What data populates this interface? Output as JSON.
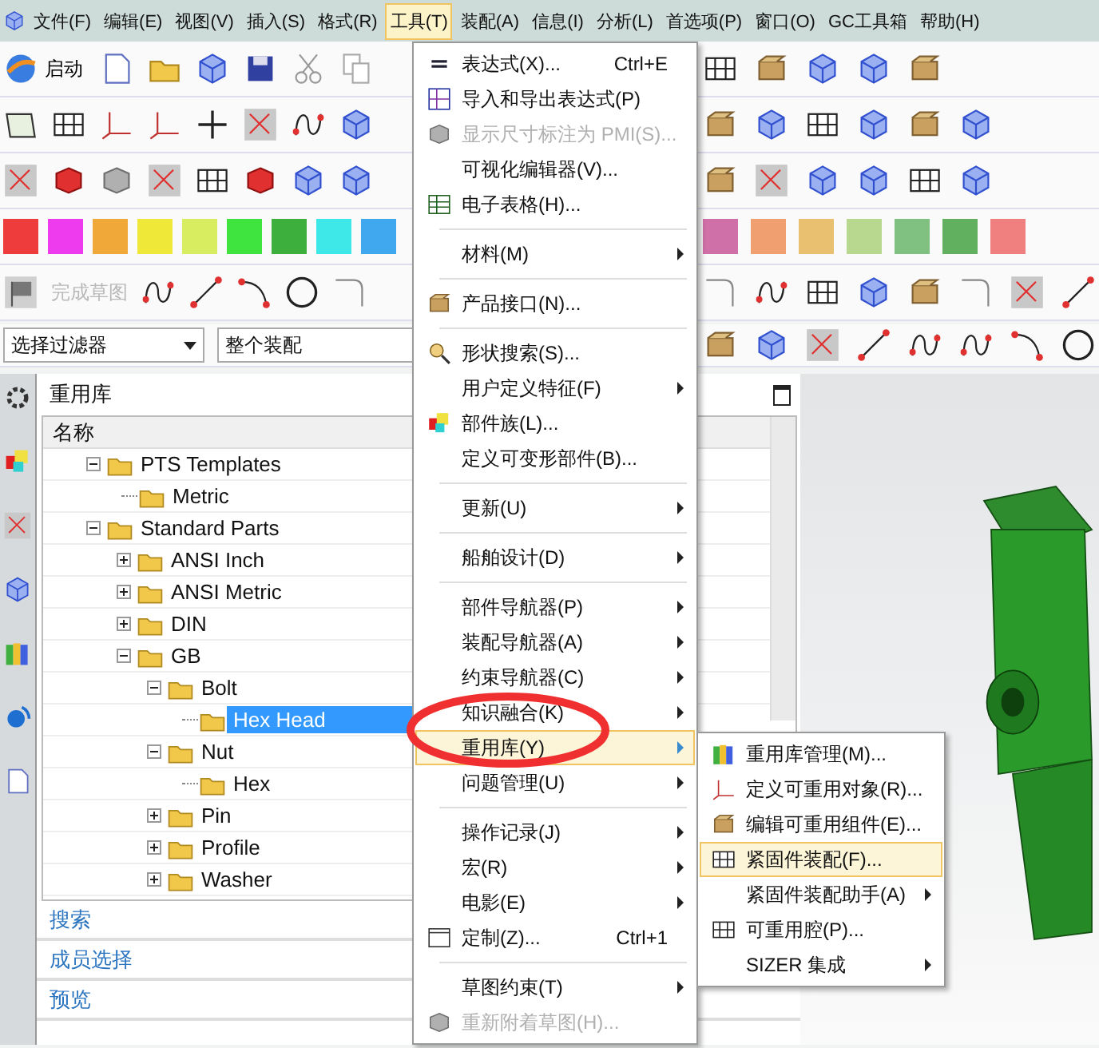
{
  "menubar": [
    {
      "label": "文件(F)",
      "selected": false
    },
    {
      "label": "编辑(E)",
      "selected": false
    },
    {
      "label": "视图(V)",
      "selected": false
    },
    {
      "label": "插入(S)",
      "selected": false
    },
    {
      "label": "格式(R)",
      "selected": false
    },
    {
      "label": "工具(T)",
      "selected": true
    },
    {
      "label": "装配(A)",
      "selected": false
    },
    {
      "label": "信息(I)",
      "selected": false
    },
    {
      "label": "分析(L)",
      "selected": false
    },
    {
      "label": "首选项(P)",
      "selected": false
    },
    {
      "label": "窗口(O)",
      "selected": false
    },
    {
      "label": "GC工具箱",
      "selected": false
    },
    {
      "label": "帮助(H)",
      "selected": false
    }
  ],
  "toolbar": {
    "start_button": "启动",
    "finish_sketch": {
      "label": "完成草图",
      "disabled": true
    },
    "selection_filter": "选择过滤器",
    "assembly_scope": "整个装配"
  },
  "color_swatches": [
    {
      "color": "#ee3b3b"
    },
    {
      "color": "#ee3bee"
    },
    {
      "color": "#f0a838"
    },
    {
      "color": "#f0e838"
    },
    {
      "color": "#d8ee60"
    },
    {
      "color": "#3fe43f"
    },
    {
      "color": "#3caf3c"
    },
    {
      "color": "#3fe8e8"
    },
    {
      "color": "#3fa8ee"
    },
    {
      "color": "#d070a8"
    },
    {
      "color": "#f0a070"
    },
    {
      "color": "#e8c070"
    },
    {
      "color": "#b8d890"
    },
    {
      "color": "#80c080"
    },
    {
      "color": "#60b060"
    },
    {
      "color": "#f08080"
    }
  ],
  "reuse_library": {
    "title": "重用库",
    "column": "名称",
    "tree": [
      {
        "label": "PTS Templates",
        "kind": "group",
        "expanded": true,
        "selected": false,
        "children": [
          {
            "label": "Metric",
            "kind": "leaf",
            "selected": false
          }
        ]
      },
      {
        "label": "Standard Parts",
        "kind": "group",
        "expanded": true,
        "selected": false,
        "children": [
          {
            "label": "ANSI Inch",
            "kind": "group",
            "expanded": false,
            "selected": false
          },
          {
            "label": "ANSI Metric",
            "kind": "group",
            "expanded": false,
            "selected": false
          },
          {
            "label": "DIN",
            "kind": "group",
            "expanded": false,
            "selected": false
          },
          {
            "label": "GB",
            "kind": "group",
            "expanded": true,
            "selected": false,
            "children": [
              {
                "label": "Bolt",
                "kind": "group",
                "expanded": true,
                "selected": false,
                "children": [
                  {
                    "label": "Hex Head",
                    "kind": "leaf",
                    "selected": true
                  }
                ]
              },
              {
                "label": "Nut",
                "kind": "group",
                "expanded": true,
                "selected": false,
                "children": [
                  {
                    "label": "Hex",
                    "kind": "leaf",
                    "selected": false
                  }
                ]
              },
              {
                "label": "Pin",
                "kind": "group",
                "expanded": false,
                "selected": false
              },
              {
                "label": "Profile",
                "kind": "group",
                "expanded": false,
                "selected": false
              },
              {
                "label": "Washer",
                "kind": "group",
                "expanded": false,
                "selected": false
              }
            ]
          }
        ]
      }
    ],
    "sections": [
      "搜索",
      "成员选择",
      "预览"
    ]
  },
  "tools_menu": {
    "items": [
      {
        "kind": "item",
        "label": "表达式(X)...",
        "shortcut": "Ctrl+E",
        "submenu": false,
        "disabled": false,
        "selected": false
      },
      {
        "kind": "item",
        "label": "导入和导出表达式(P)",
        "submenu": false,
        "disabled": false,
        "selected": false
      },
      {
        "kind": "item",
        "label": "显示尺寸标注为 PMI(S)...",
        "submenu": false,
        "disabled": true,
        "selected": false
      },
      {
        "kind": "item",
        "label": "可视化编辑器(V)...",
        "submenu": false,
        "disabled": false,
        "selected": false
      },
      {
        "kind": "item",
        "label": "电子表格(H)...",
        "submenu": false,
        "disabled": false,
        "selected": false
      },
      {
        "kind": "separator"
      },
      {
        "kind": "item",
        "label": "材料(M)",
        "submenu": true,
        "disabled": false,
        "selected": false
      },
      {
        "kind": "separator"
      },
      {
        "kind": "item",
        "label": "产品接口(N)...",
        "submenu": false,
        "disabled": false,
        "selected": false
      },
      {
        "kind": "separator"
      },
      {
        "kind": "item",
        "label": "形状搜索(S)...",
        "submenu": false,
        "disabled": false,
        "selected": false
      },
      {
        "kind": "item",
        "label": "用户定义特征(F)",
        "submenu": true,
        "disabled": false,
        "selected": false
      },
      {
        "kind": "item",
        "label": "部件族(L)...",
        "submenu": false,
        "disabled": false,
        "selected": false
      },
      {
        "kind": "item",
        "label": "定义可变形部件(B)...",
        "submenu": false,
        "disabled": false,
        "selected": false
      },
      {
        "kind": "separator"
      },
      {
        "kind": "item",
        "label": "更新(U)",
        "submenu": true,
        "disabled": false,
        "selected": false
      },
      {
        "kind": "separator"
      },
      {
        "kind": "item",
        "label": "船舶设计(D)",
        "submenu": true,
        "disabled": false,
        "selected": false
      },
      {
        "kind": "separator"
      },
      {
        "kind": "item",
        "label": "部件导航器(P)",
        "submenu": true,
        "disabled": false,
        "selected": false
      },
      {
        "kind": "item",
        "label": "装配导航器(A)",
        "submenu": true,
        "disabled": false,
        "selected": false
      },
      {
        "kind": "item",
        "label": "约束导航器(C)",
        "submenu": true,
        "disabled": false,
        "selected": false
      },
      {
        "kind": "item",
        "label": "知识融合(K)",
        "submenu": true,
        "disabled": false,
        "selected": false
      },
      {
        "kind": "item",
        "label": "重用库(Y)",
        "submenu": true,
        "disabled": false,
        "selected": true
      },
      {
        "kind": "item",
        "label": "问题管理(U)",
        "submenu": true,
        "disabled": false,
        "selected": false
      },
      {
        "kind": "separator"
      },
      {
        "kind": "item",
        "label": "操作记录(J)",
        "submenu": true,
        "disabled": false,
        "selected": false
      },
      {
        "kind": "item",
        "label": "宏(R)",
        "submenu": true,
        "disabled": false,
        "selected": false
      },
      {
        "kind": "item",
        "label": "电影(E)",
        "submenu": true,
        "disabled": false,
        "selected": false
      },
      {
        "kind": "item",
        "label": "定制(Z)...",
        "shortcut": "Ctrl+1",
        "submenu": false,
        "disabled": false,
        "selected": false
      },
      {
        "kind": "separator"
      },
      {
        "kind": "item",
        "label": "草图约束(T)",
        "submenu": true,
        "disabled": false,
        "selected": false
      },
      {
        "kind": "item",
        "label": "重新附着草图(H)...",
        "submenu": false,
        "disabled": true,
        "selected": false
      }
    ]
  },
  "reuse_submenu": {
    "items": [
      {
        "kind": "item",
        "label": "重用库管理(M)...",
        "submenu": false,
        "disabled": false,
        "selected": false
      },
      {
        "kind": "item",
        "label": "定义可重用对象(R)...",
        "submenu": false,
        "disabled": false,
        "selected": false
      },
      {
        "kind": "item",
        "label": "编辑可重用组件(E)...",
        "submenu": false,
        "disabled": false,
        "selected": false
      },
      {
        "kind": "item",
        "label": "紧固件装配(F)...",
        "submenu": false,
        "disabled": false,
        "selected": true
      },
      {
        "kind": "item",
        "label": "紧固件装配助手(A)",
        "submenu": true,
        "disabled": false,
        "selected": false
      },
      {
        "kind": "item",
        "label": "可重用腔(P)...",
        "submenu": false,
        "disabled": false,
        "selected": false
      },
      {
        "kind": "item",
        "label": "SIZER 集成",
        "submenu": true,
        "disabled": false,
        "selected": false
      }
    ]
  }
}
